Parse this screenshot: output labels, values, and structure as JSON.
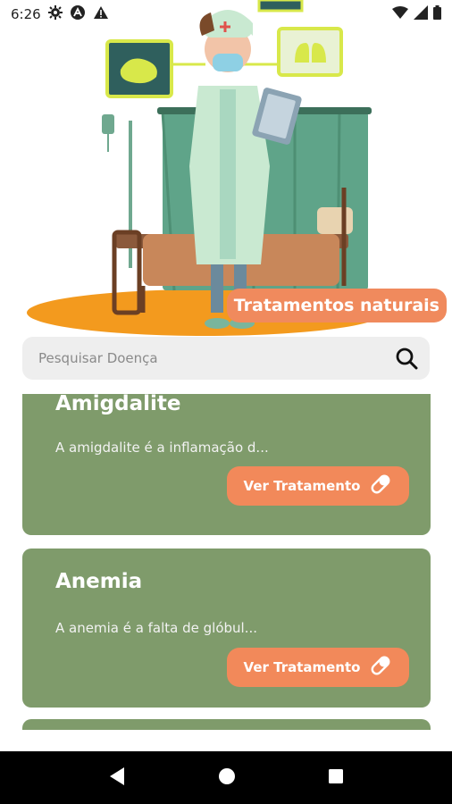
{
  "status": {
    "time": "6:26",
    "left_icons": [
      "settings-icon",
      "app-notification-icon",
      "warning-icon"
    ],
    "right_icons": [
      "wifi-icon",
      "signal-icon",
      "battery-icon"
    ]
  },
  "hero": {
    "badge_label": "Tratamentos naturais",
    "colors": {
      "badge": "#f08a5d",
      "curtain": "#5fa489",
      "floor": "#f39a1e",
      "bed": "#c8875a"
    }
  },
  "search": {
    "placeholder": "Pesquisar Doença",
    "icon": "search-icon"
  },
  "diseases": [
    {
      "title": "Amigdalite",
      "description": "A amigdalite é a inflamação d...",
      "button_label": "Ver Tratamento",
      "button_icon": "pill-icon"
    },
    {
      "title": "Anemia",
      "description": "A anemia é a falta de glóbul...",
      "button_label": "Ver Tratamento",
      "button_icon": "pill-icon"
    }
  ],
  "colors": {
    "card_bg": "#7f9b6b",
    "button_bg": "#f2895a",
    "search_bg": "#eeeeee",
    "nav_bg": "#000000"
  },
  "navigation": {
    "icons": [
      "back-icon",
      "home-icon",
      "recents-icon"
    ]
  }
}
